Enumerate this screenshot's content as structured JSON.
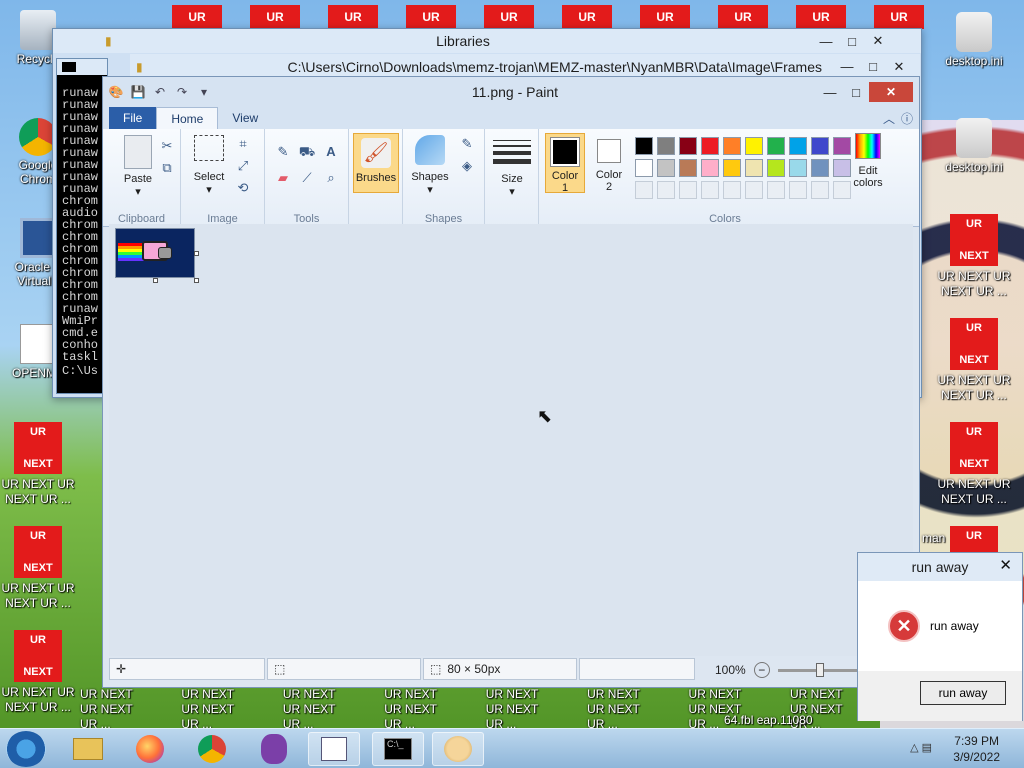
{
  "desktop": {
    "icons": [
      {
        "id": "recycle",
        "label": "Recycle"
      },
      {
        "id": "chrome",
        "label": "Google Chrom"
      },
      {
        "id": "virtualbox",
        "label": "Oracle V VirtualB"
      },
      {
        "id": "openme",
        "label": "OPENME"
      },
      {
        "id": "desktop_ini_1",
        "label": "desktop.ini"
      },
      {
        "id": "desktop_ini_2",
        "label": "desktop.ini"
      }
    ],
    "ur_box": {
      "top": "UR",
      "bottom": "NEXT"
    },
    "ur_caption": "UR NEXT UR NEXT UR ...",
    "ur_caption_line1": "UR NEXT UR",
    "ur_caption_line2": "NEXT UR ...",
    "ur_next_cut": "UR NEXT UR NEXT UR ...",
    "partial_text": "64.fbl eap.11080",
    "partial_text2": "man"
  },
  "libraries": {
    "title": "Libraries"
  },
  "nyan_window": {
    "path": "C:\\Users\\Cirno\\Downloads\\memz-trojan\\MEMZ-master\\NyanMBR\\Data\\Image\\Frames"
  },
  "cmd": {
    "lines": [
      "runaw",
      "runaw",
      "runaw",
      "runaw",
      "runaw",
      "runaw",
      "runaw",
      "runaw",
      "runaw",
      "chrom",
      "audio",
      "chrom",
      "chrom",
      "chrom",
      "chrom",
      "chrom",
      "chrom",
      "chrom",
      "runaw",
      "WmiPr",
      "cmd.e",
      "conho",
      "taskl"
    ],
    "prompt": "C:\\Us"
  },
  "paint": {
    "title": "11.png - Paint",
    "tabs": {
      "file": "File",
      "home": "Home",
      "view": "View"
    },
    "clipboard": {
      "paste": "Paste",
      "label": "Clipboard"
    },
    "image": {
      "select": "Select",
      "label": "Image"
    },
    "tools": {
      "label": "Tools"
    },
    "brushes": "Brushes",
    "shapes": {
      "button": "Shapes",
      "label": "Shapes"
    },
    "size": "Size",
    "color1": {
      "line1": "Color",
      "line2": "1"
    },
    "color2": {
      "line1": "Color",
      "line2": "2"
    },
    "colors_label": "Colors",
    "edit_colors": {
      "line1": "Edit",
      "line2": "colors"
    },
    "palette_row1": [
      "#000000",
      "#7f7f7f",
      "#880015",
      "#ed1c24",
      "#ff7f27",
      "#fff200",
      "#22b14c",
      "#00a2e8",
      "#3f48cc",
      "#a349a4"
    ],
    "palette_row2": [
      "#ffffff",
      "#c3c3c3",
      "#b97a57",
      "#ffaec9",
      "#ffc90e",
      "#efe4b0",
      "#b5e61d",
      "#99d9ea",
      "#7092be",
      "#c8bfe7"
    ],
    "status": {
      "dimensions": "80 × 50px",
      "zoom": "100%"
    }
  },
  "dialog": {
    "title": "run away",
    "message": "run away",
    "button": "run away"
  },
  "taskbar": {
    "time": "7:39 PM",
    "date": "3/9/2022"
  }
}
